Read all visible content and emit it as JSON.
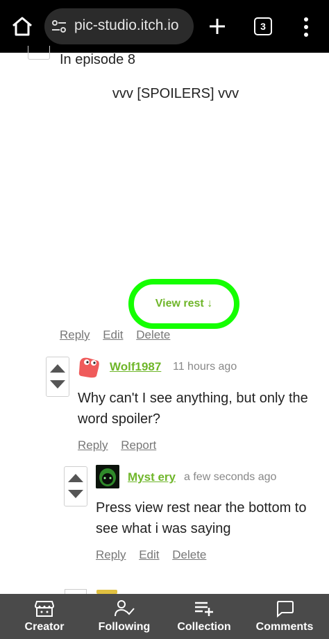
{
  "browser": {
    "url": "pic-studio.itch.io",
    "tab_count": "3",
    "icons": [
      "home-icon",
      "tune-icon",
      "plus-icon",
      "tabs-icon",
      "more-vert-icon"
    ]
  },
  "thread": {
    "partial_text": "In episode 8",
    "spoiler_text": "vvv [SPOILERS] vvv",
    "view_rest": "View rest ↓",
    "highlight_color": "#14ff00",
    "actions": {
      "reply": "Reply",
      "edit": "Edit",
      "delete": "Delete"
    }
  },
  "comments": [
    {
      "user": "Wolf1987",
      "time": "11 hours ago",
      "body_line1": "Why can't I see anything, but only the",
      "body_line2": "word spoiler?",
      "actions": {
        "reply": "Reply",
        "report": "Report"
      }
    },
    {
      "user": "Myst ery",
      "time": "a few seconds ago",
      "body_line1": "Press view rest near the bottom to",
      "body_line2": "see what i was saying",
      "actions": {
        "reply": "Reply",
        "edit": "Edit",
        "delete": "Delete"
      }
    }
  ],
  "colors": {
    "accent": "#6fb62a",
    "nav_bg": "#4a4a4a",
    "topbar_bg": "#000000"
  },
  "nav": [
    {
      "label": "Creator",
      "icon": "store-icon"
    },
    {
      "label": "Following",
      "icon": "person-check-icon"
    },
    {
      "label": "Collection",
      "icon": "playlist-add-icon"
    },
    {
      "label": "Comments",
      "icon": "comment-icon"
    }
  ]
}
